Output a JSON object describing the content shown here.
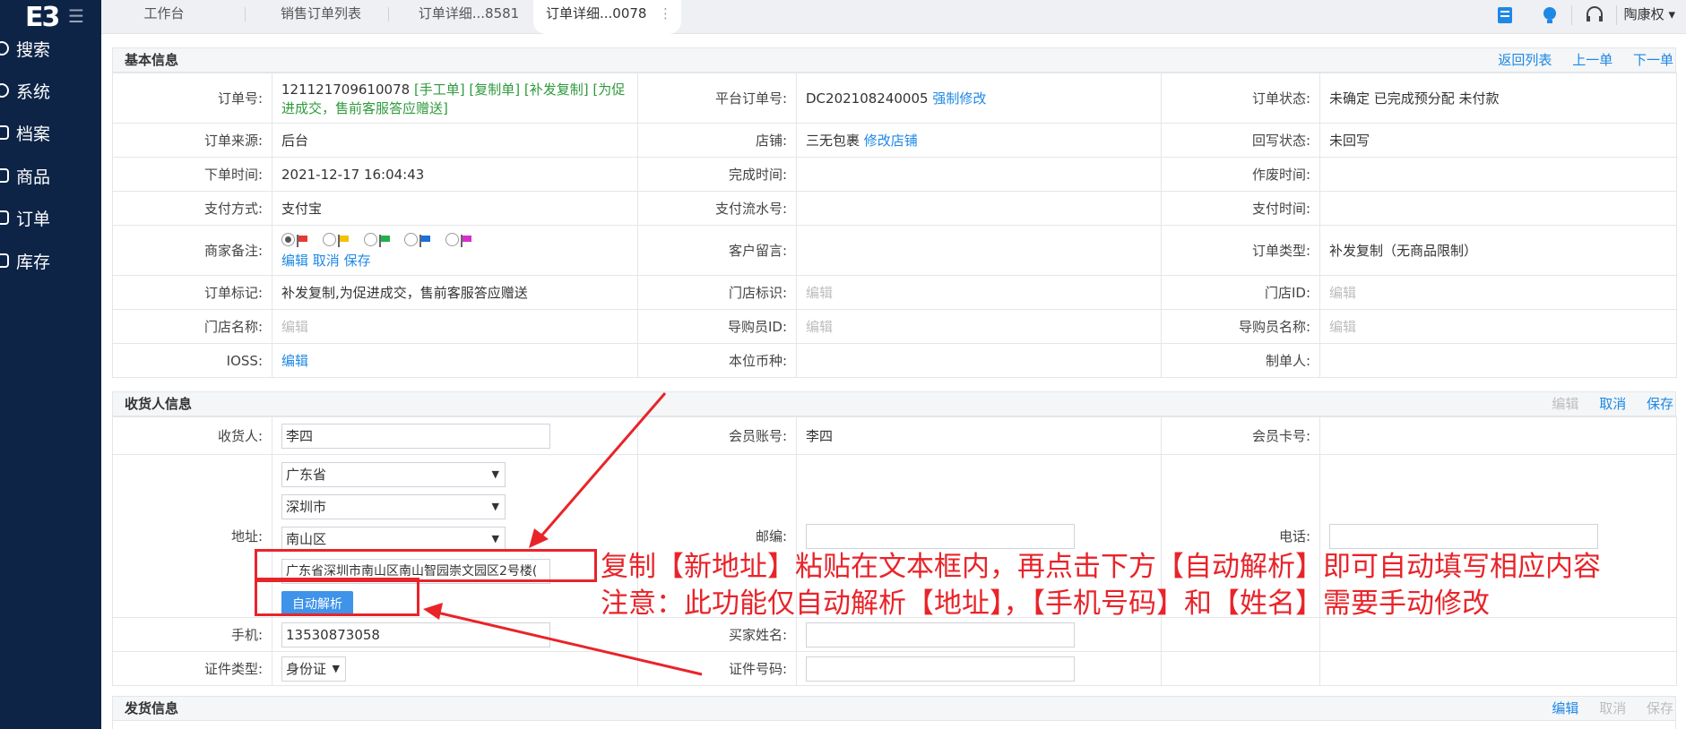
{
  "sidebar": {
    "logo": "E3",
    "items": [
      {
        "label": "搜索",
        "icon": "search-icon"
      },
      {
        "label": "系统",
        "icon": "gear-icon"
      },
      {
        "label": "档案",
        "icon": "archive-icon"
      },
      {
        "label": "商品",
        "icon": "box-icon"
      },
      {
        "label": "订单",
        "icon": "order-icon"
      },
      {
        "label": "库存",
        "icon": "warehouse-icon"
      }
    ]
  },
  "tabs": [
    {
      "label": "工作台"
    },
    {
      "label": "销售订单列表"
    },
    {
      "label": "订单详细...8581"
    },
    {
      "label": "订单详细...0078"
    }
  ],
  "header": {
    "user": "陶康权"
  },
  "basic": {
    "title": "基本信息",
    "links": {
      "back": "返回列表",
      "prev": "上一单",
      "next": "下一单"
    },
    "order_no_label": "订单号:",
    "order_no": "121121709610078",
    "order_tags": "[手工单] [复制单] [补发复制] [为促进成交，售前客服答应赠送]",
    "platform_no_label": "平台订单号:",
    "platform_no": "DC202108240005",
    "force_edit": "强制修改",
    "status_label": "订单状态:",
    "status": "未确定 已完成预分配 未付款",
    "source_label": "订单来源:",
    "source": "后台",
    "shop_label": "店铺:",
    "shop": "三无包裹",
    "edit_shop": "修改店铺",
    "writeback_label": "回写状态:",
    "writeback": "未回写",
    "order_time_label": "下单时间:",
    "order_time": "2021-12-17 16:04:43",
    "finish_time_label": "完成时间:",
    "void_time_label": "作废时间:",
    "pay_method_label": "支付方式:",
    "pay_method": "支付宝",
    "pay_serial_label": "支付流水号:",
    "pay_time_label": "支付时间:",
    "merchant_note_label": "商家备注:",
    "note_edit": "编辑",
    "note_cancel": "取消",
    "note_save": "保存",
    "customer_msg_label": "客户留言:",
    "order_type_label": "订单类型:",
    "order_type": "补发复制（无商品限制）",
    "mark_label": "订单标记:",
    "mark": "补发复制,为促进成交，售前客服答应赠送",
    "store_tag_label": "门店标识:",
    "store_tag": "编辑",
    "store_id_label": "门店ID:",
    "store_id": "编辑",
    "store_name_label": "门店名称:",
    "store_name": "编辑",
    "guide_id_label": "导购员ID:",
    "guide_id": "编辑",
    "guide_name_label": "导购员名称:",
    "guide_name": "编辑",
    "ioss_label": "IOSS:",
    "ioss": "编辑",
    "currency_label": "本位币种:",
    "maker_label": "制单人:"
  },
  "receiver": {
    "title": "收货人信息",
    "links": {
      "edit": "编辑",
      "cancel": "取消",
      "save": "保存"
    },
    "name_label": "收货人:",
    "name": "李四",
    "member_label": "会员账号:",
    "member": "李四",
    "card_label": "会员卡号:",
    "address_label": "地址:",
    "province": "广东省",
    "city": "深圳市",
    "district": "南山区",
    "address_text": "广东省深圳市南山区南山智园崇文园区2号楼(",
    "parse_button": "自动解析",
    "zip_label": "邮编:",
    "phone_label": "电话:",
    "mobile_label": "手机:",
    "mobile": "13530873058",
    "buyer_label": "买家姓名:",
    "id_type_label": "证件类型:",
    "id_type": "身份证",
    "id_no_label": "证件号码:"
  },
  "shipping": {
    "title": "发货信息",
    "links": {
      "edit": "编辑",
      "cancel": "取消",
      "save": "保存"
    }
  },
  "annotation": {
    "line1": "复制【新地址】粘贴在文本框内，再点击下方【自动解析】即可自动填写相应内容",
    "line2": "注意：此功能仅自动解析【地址】，【手机号码】和【姓名】需要手动修改"
  },
  "flags": [
    "#e53935",
    "#f2c200",
    "#22b04b",
    "#1e6fd9",
    "#d62fc9"
  ]
}
